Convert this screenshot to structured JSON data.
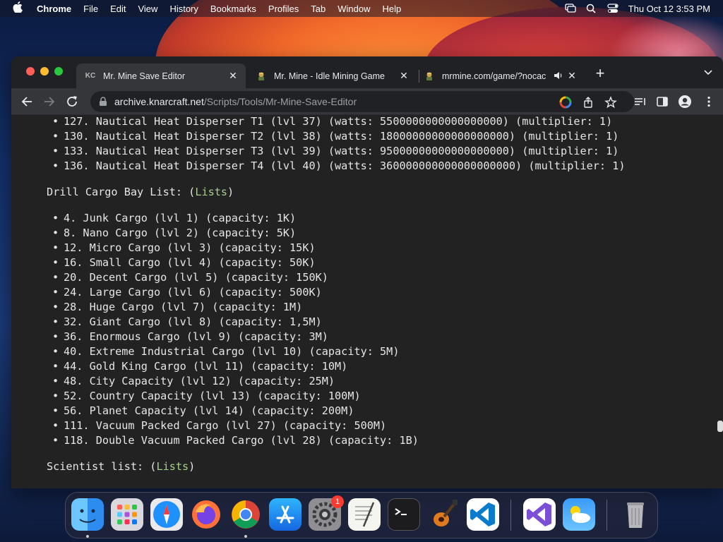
{
  "menubar": {
    "app_name": "Chrome",
    "items": [
      "File",
      "Edit",
      "View",
      "History",
      "Bookmarks",
      "Profiles",
      "Tab",
      "Window",
      "Help"
    ],
    "clock": "Thu Oct 12  3:53 PM"
  },
  "tabs": [
    {
      "label": "Mr. Mine Save Editor",
      "favicon": "KC",
      "active": true
    },
    {
      "label": "Mr. Mine - Idle Mining Game",
      "favicon": "miner-icon",
      "active": false
    },
    {
      "label": "mrmine.com/game/?nocac",
      "favicon": "miner-icon",
      "active": false,
      "audio": true
    }
  ],
  "address_bar": {
    "host": "archive.knarcraft.net",
    "path": "/Scripts/Tools/Mr-Mine-Save-Editor"
  },
  "content": {
    "heat_list": [
      "127. Nautical Heat Disperser T1 (lvl 37) (watts: 5500000000000000000) (multiplier: 1)",
      "130. Nautical Heat Disperser T2 (lvl 38) (watts: 18000000000000000000) (multiplier: 1)",
      "133. Nautical Heat Disperser T3 (lvl 39) (watts: 95000000000000000000) (multiplier: 1)",
      "136. Nautical Heat Disperser T4 (lvl 40) (watts: 360000000000000000000) (multiplier: 1)"
    ],
    "cargo_heading": "Drill Cargo Bay List: (",
    "cargo_link": "Lists",
    "cargo_heading_end": ")",
    "cargo_list": [
      "4. Junk Cargo (lvl 1) (capacity: 1K)",
      "8. Nano Cargo (lvl 2) (capacity: 5K)",
      "12. Micro Cargo (lvl 3) (capacity: 15K)",
      "16. Small Cargo (lvl 4) (capacity: 50K)",
      "20. Decent Cargo (lvl 5) (capacity: 150K)",
      "24. Large Cargo (lvl 6) (capacity: 500K)",
      "28. Huge Cargo (lvl 7) (capacity: 1M)",
      "32. Giant Cargo (lvl 8) (capacity: 1,5M)",
      "36. Enormous Cargo (lvl 9) (capacity: 3M)",
      "40. Extreme Industrial Cargo (lvl 10) (capacity: 5M)",
      "44. Gold King Cargo (lvl 11) (capacity: 10M)",
      "48. City Capacity (lvl 12) (capacity: 25M)",
      "52. Country Capacity (lvl 13) (capacity: 100M)",
      "56. Planet Capacity (lvl 14) (capacity: 200M)",
      "111. Vacuum Packed Cargo (lvl 27) (capacity: 500M)",
      "118. Double Vacuum Packed Cargo (lvl 28) (capacity: 1B)"
    ],
    "scientist_heading": "Scientist list: (",
    "scientist_link": "Lists",
    "scientist_heading_end": ")"
  },
  "dock": {
    "apps": [
      "finder-icon",
      "launchpad-icon",
      "safari-icon",
      "firefox-icon",
      "chrome-icon",
      "app-store-icon",
      "system-settings-icon",
      "textedit-icon",
      "terminal-icon",
      "garageband-icon",
      "vscode-icon",
      "visual-studio-icon",
      "weather-icon",
      "trash-icon"
    ],
    "settings_badge": "1"
  },
  "colors": {
    "page_bg": "#222222",
    "link": "#a8d08d",
    "tab_active": "#35363a"
  }
}
